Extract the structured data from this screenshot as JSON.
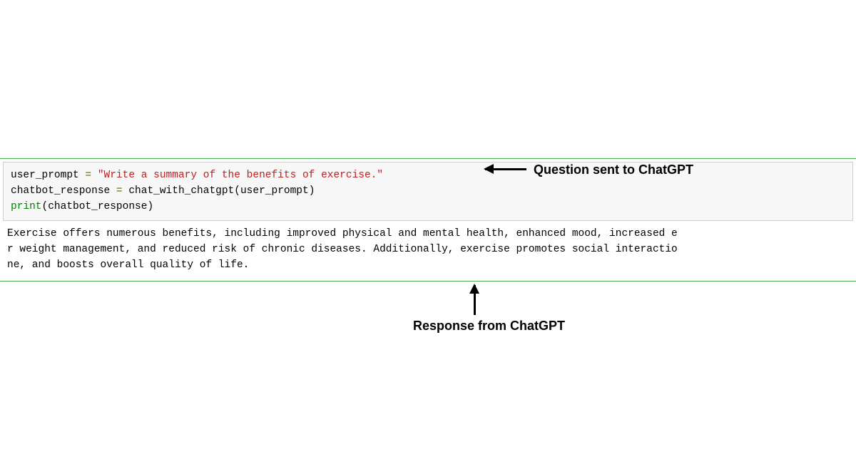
{
  "code": {
    "line1_var": "user_prompt",
    "line1_eq": " = ",
    "line1_str": "\"Write a summary of the benefits of exercise.\"",
    "line2_var": "chatbot_response",
    "line2_eq": " = ",
    "line2_func": "chat_with_chatgpt",
    "line2_open": "(",
    "line2_arg": "user_prompt",
    "line2_close": ")",
    "line3_builtin": "print",
    "line3_open": "(",
    "line3_arg": "chatbot_response",
    "line3_close": ")"
  },
  "output": {
    "line1": "Exercise offers numerous benefits, including improved physical and mental health, enhanced mood, increased e",
    "line2": "r weight management, and reduced risk of chronic diseases. Additionally, exercise promotes social interactio",
    "line3": "ne, and boosts overall quality of life."
  },
  "annotations": {
    "question": "Question sent to ChatGPT",
    "response": "Response from ChatGPT"
  }
}
